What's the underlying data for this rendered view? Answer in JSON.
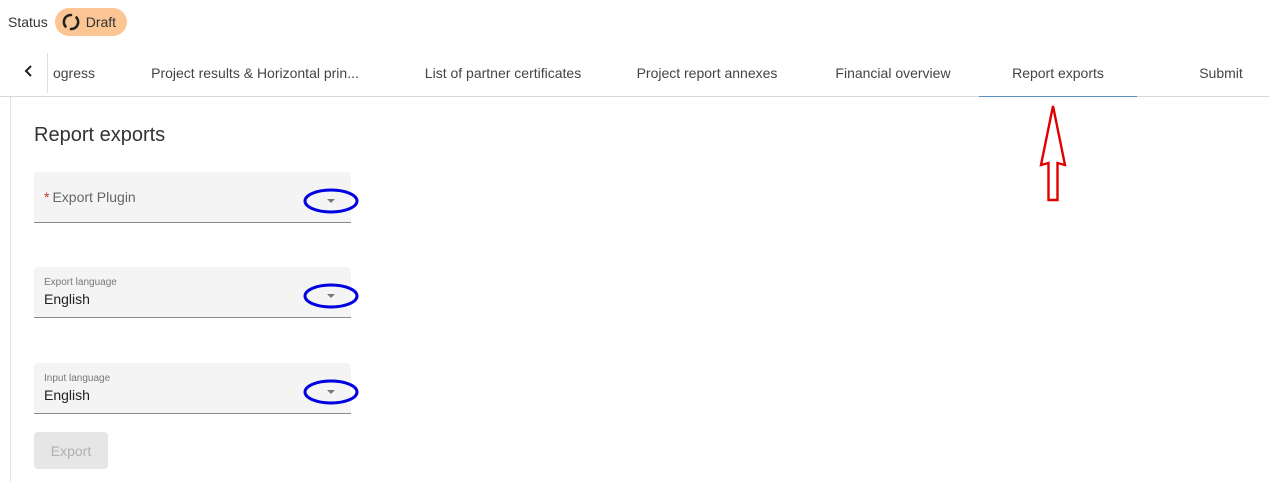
{
  "status": {
    "label": "Status",
    "chip": "Draft",
    "chip_color": "#fbc693"
  },
  "tabs": [
    {
      "label": "ogress"
    },
    {
      "label": "Project results & Horizontal prin..."
    },
    {
      "label": "List of partner certificates"
    },
    {
      "label": "Project report annexes"
    },
    {
      "label": "Financial overview"
    },
    {
      "label": "Report exports",
      "active": true
    },
    {
      "label": "Submit"
    }
  ],
  "page": {
    "title": "Report exports"
  },
  "form": {
    "export_plugin": {
      "required_mark": "*",
      "placeholder": "Export Plugin"
    },
    "export_language": {
      "label": "Export language",
      "value": "English"
    },
    "input_language": {
      "label": "Input language",
      "value": "English"
    },
    "export_button": "Export"
  },
  "icons": {
    "back": "chevron-left-icon",
    "status": "loading-circle-icon",
    "dropdown": "caret-down-icon",
    "annotation": "up-arrow-icon"
  },
  "colors": {
    "active_tab": "#5b8fc7",
    "highlight_ring": "#0000e0",
    "annotation_arrow": "#e00000"
  }
}
